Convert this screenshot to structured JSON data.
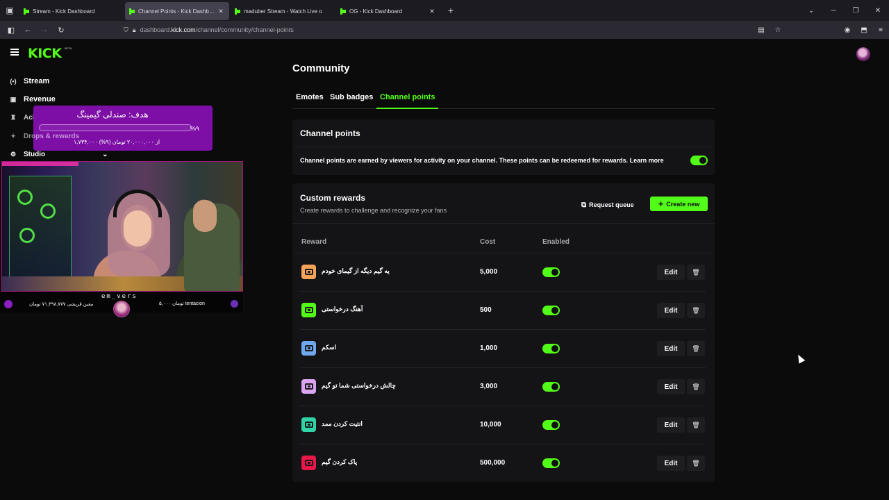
{
  "browser": {
    "tabs": [
      {
        "label": "Stream - Kick Dashboard",
        "active": false
      },
      {
        "label": "Channel Points - Kick Dashboard",
        "active": true
      },
      {
        "label": "maduber Stream - Watch Live o",
        "active": false
      },
      {
        "label": "OG - Kick Dashboard",
        "active": false
      }
    ],
    "new_tab": "+",
    "url_prefix": "dashboard.",
    "url_host": "kick.com",
    "url_path": "/channel/community/channel-points"
  },
  "app": {
    "logo": "KICK",
    "logo_badge": "BETA"
  },
  "sidebar": {
    "items": [
      {
        "label": "Stream",
        "icon": "broadcast-icon"
      },
      {
        "label": "Revenue",
        "icon": "revenue-icon"
      },
      {
        "label": "Achievements",
        "icon": "trophy-icon"
      },
      {
        "label": "Drops & rewards",
        "icon": "gift-icon"
      },
      {
        "label": "Studio",
        "icon": "studio-icon"
      }
    ]
  },
  "overlay": {
    "goal_title": "هدف: صندلی گیمینگ",
    "goal_percent": "%۹",
    "goal_amount": "۱,۷۳۴,۰۰۰ از ۲۰,۰۰۰,۰۰۰ تومان (۹%)",
    "streamer_name": "em_vers",
    "ticker_left": "معین قریشی ۷۱,۳۹۸,۷۷۷ تومان",
    "ticker_right": "۵,۰۰۰ تومان tentacion"
  },
  "main": {
    "title": "Community",
    "tabs": [
      {
        "label": "Emotes",
        "active": false
      },
      {
        "label": "Sub badges",
        "active": false
      },
      {
        "label": "Channel points",
        "active": true
      }
    ],
    "channel_points": {
      "title": "Channel points",
      "description": "Channel points are earned by viewers for activity on your channel. These points can be redeemed for rewards. Learn more",
      "enabled": true
    },
    "custom_rewards": {
      "title": "Custom rewards",
      "subtitle": "Create rewards to challenge and recognize your fans",
      "request_queue_label": "Request queue",
      "create_new_label": "Create new",
      "columns": {
        "reward": "Reward",
        "cost": "Cost",
        "enabled": "Enabled"
      },
      "edit_label": "Edit",
      "rows": [
        {
          "name": "یه گیم دیگه از گیمای خودم",
          "cost": "5,000",
          "enabled": true,
          "color": "#f5a35b"
        },
        {
          "name": "آهنگ درخواستی",
          "cost": "500",
          "enabled": true,
          "color": "#53fc18"
        },
        {
          "name": "اسکم",
          "cost": "1,000",
          "enabled": true,
          "color": "#6fa8ef"
        },
        {
          "name": "چالش درخواستی شما تو گیم",
          "cost": "3,000",
          "enabled": true,
          "color": "#d9a4f2"
        },
        {
          "name": "انتیت کردن ممد",
          "cost": "10,000",
          "enabled": true,
          "color": "#2fd3a6"
        },
        {
          "name": "پاک کردن گیم",
          "cost": "500,000",
          "enabled": true,
          "color": "#e8174a"
        }
      ]
    }
  }
}
